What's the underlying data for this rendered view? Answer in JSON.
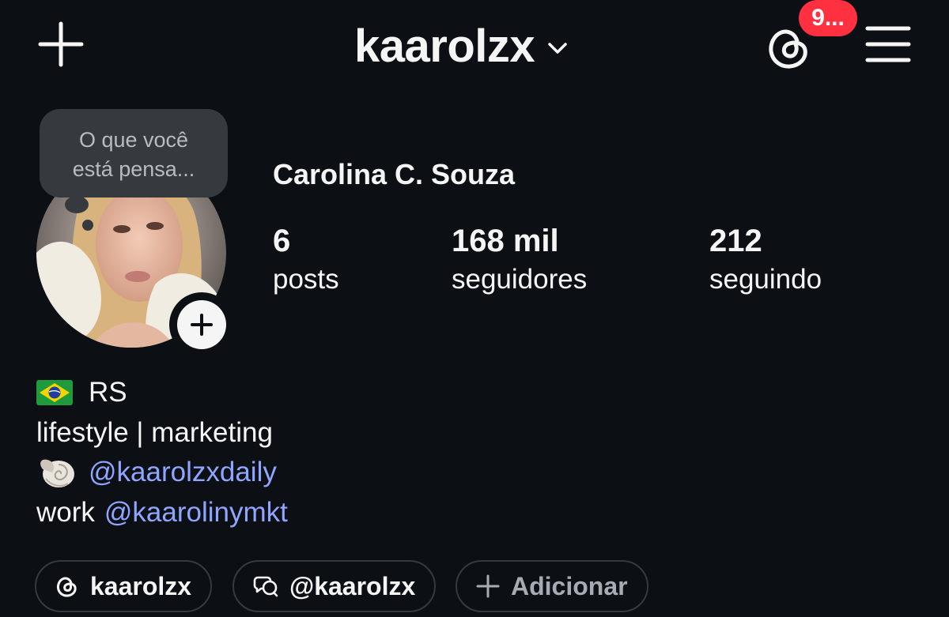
{
  "header": {
    "username": "kaarolzx",
    "threads_badge": "9...",
    "icons": [
      "plus-icon",
      "chevron-down-icon",
      "threads-icon",
      "hamburger-menu-icon"
    ]
  },
  "note": {
    "placeholder": "O que você está pensa..."
  },
  "profile": {
    "full_name": "Carolina C. Souza",
    "stats": [
      {
        "value": "6",
        "label": "posts"
      },
      {
        "value": "168 mil",
        "label": "seguidores"
      },
      {
        "value": "212",
        "label": "seguindo"
      }
    ]
  },
  "bio": {
    "line1_flag": "brazil-flag-icon",
    "line1_text": "RS",
    "line2_text": "lifestyle | marketing",
    "line3_icon": "spiral-shell-icon",
    "line3_mention": "@kaarolzxdaily",
    "line4_prefix": "work",
    "line4_mention": "@kaarolinymkt"
  },
  "chips": [
    {
      "icon": "threads-icon",
      "label": "kaarolzx"
    },
    {
      "icon": "messenger-chat-icon",
      "label": "@kaarolzx"
    },
    {
      "icon": "plus-icon",
      "label": "Adicionar"
    }
  ],
  "colors": {
    "background": "#0c1014",
    "text": "#f5f5f5",
    "link": "#8fa5ff",
    "badge": "#ff3040",
    "bubble": "#363a3f"
  }
}
